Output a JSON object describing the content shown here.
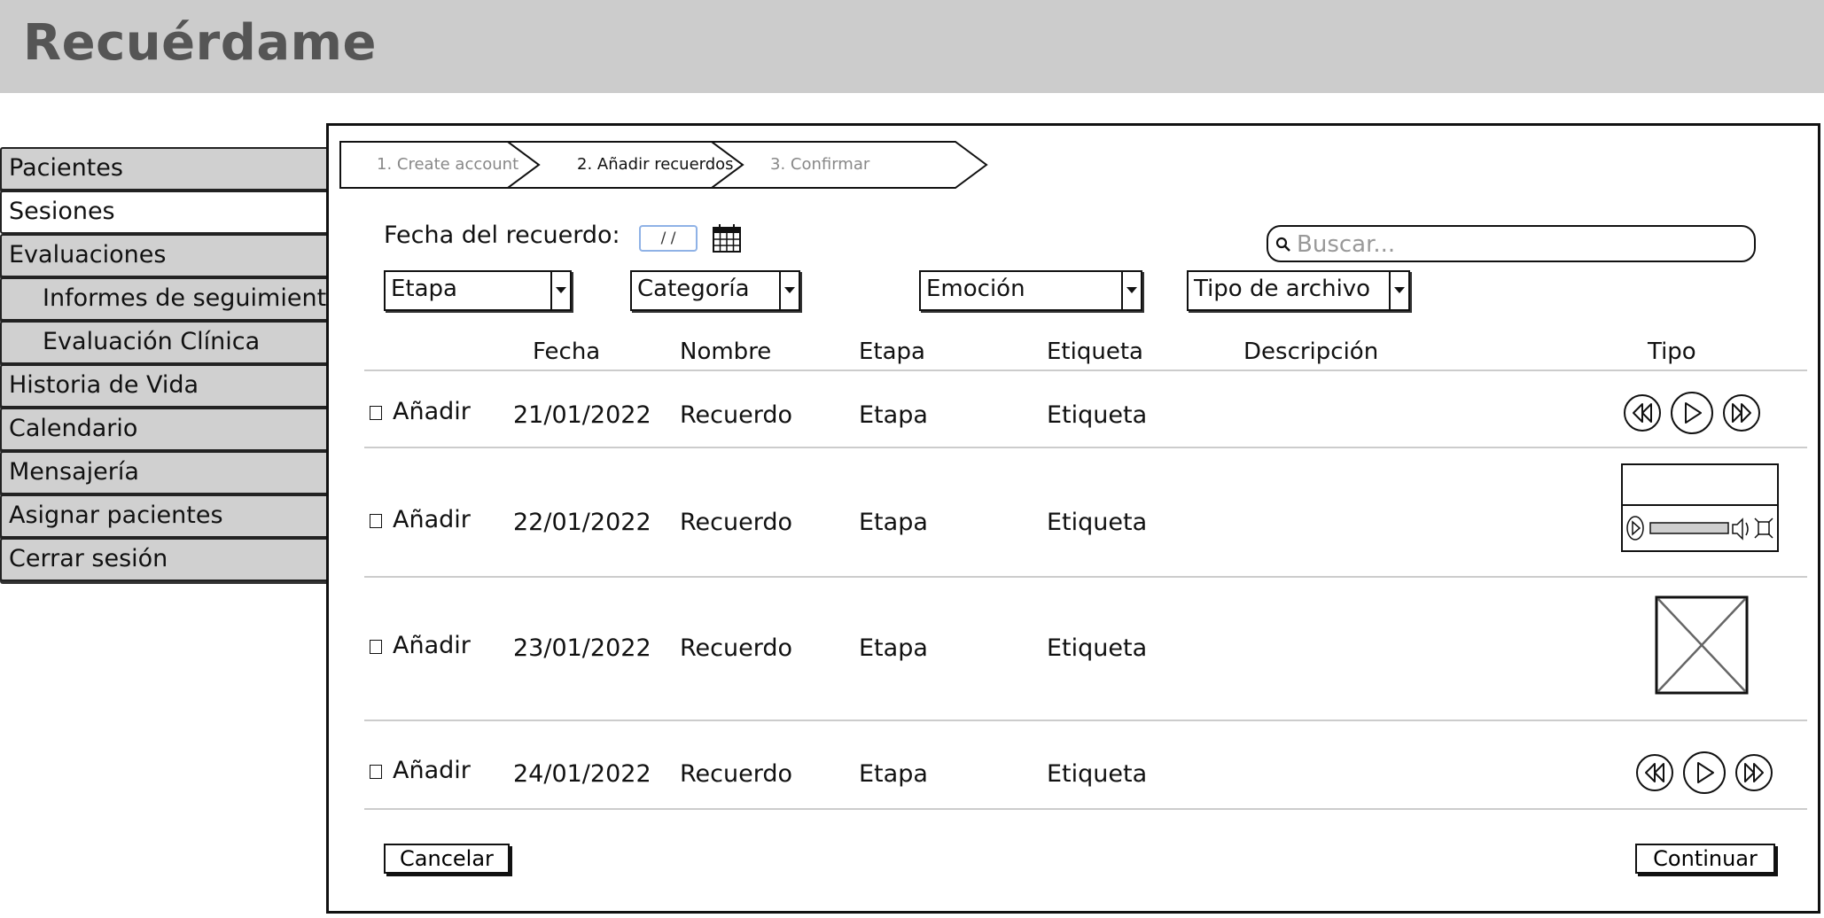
{
  "app": {
    "title": "Recuérdame"
  },
  "sidebar": {
    "items": [
      {
        "label": "Pacientes"
      },
      {
        "label": "Sesiones"
      },
      {
        "label": "Evaluaciones"
      },
      {
        "label": "Informes de seguimiento"
      },
      {
        "label": "Evaluación Clínica"
      },
      {
        "label": "Historia de Vida"
      },
      {
        "label": "Calendario"
      },
      {
        "label": "Mensajería"
      },
      {
        "label": "Asignar pacientes"
      },
      {
        "label": "Cerrar sesión"
      }
    ]
  },
  "wizard": {
    "steps": [
      {
        "label": "1. Create account"
      },
      {
        "label": "2. Añadir recuerdos"
      },
      {
        "label": "3. Confirmar"
      }
    ]
  },
  "form": {
    "fecha_label": "Fecha del recuerdo:",
    "date_value": "/ /",
    "search_placeholder": "Buscar...",
    "filters": {
      "etapa": "Etapa",
      "categoria": "Categoría",
      "emocion": "Emoción",
      "tipo_archivo": "Tipo de archivo"
    }
  },
  "table": {
    "headers": {
      "fecha": "Fecha",
      "nombre": "Nombre",
      "etapa": "Etapa",
      "etiqueta": "Etiqueta",
      "descripcion": "Descripción",
      "tipo": "Tipo"
    },
    "rows": [
      {
        "check_label": "Añadir",
        "fecha": "21/01/2022",
        "nombre": "Recuerdo",
        "etapa": "Etapa",
        "etiqueta": "Etiqueta",
        "descripcion": "",
        "tipo": "audio"
      },
      {
        "check_label": "Añadir",
        "fecha": "22/01/2022",
        "nombre": "Recuerdo",
        "etapa": "Etapa",
        "etiqueta": "Etiqueta",
        "descripcion": "",
        "tipo": "video"
      },
      {
        "check_label": "Añadir",
        "fecha": "23/01/2022",
        "nombre": "Recuerdo",
        "etapa": "Etapa",
        "etiqueta": "Etiqueta",
        "descripcion": "",
        "tipo": "image"
      },
      {
        "check_label": "Añadir",
        "fecha": "24/01/2022",
        "nombre": "Recuerdo",
        "etapa": "Etapa",
        "etiqueta": "Etiqueta",
        "descripcion": "",
        "tipo": "audio"
      }
    ]
  },
  "actions": {
    "cancel_label": "Cancelar",
    "continue_label": "Continuar"
  },
  "icons": {
    "calendar": "calendar-icon",
    "search": "search-icon",
    "dropdown": "chevron-down-icon",
    "rewind": "rewind-icon",
    "play": "play-icon",
    "fast_forward": "fast-forward-icon",
    "volume": "volume-icon",
    "fullscreen": "fullscreen-icon",
    "image_placeholder": "image-placeholder-icon"
  }
}
